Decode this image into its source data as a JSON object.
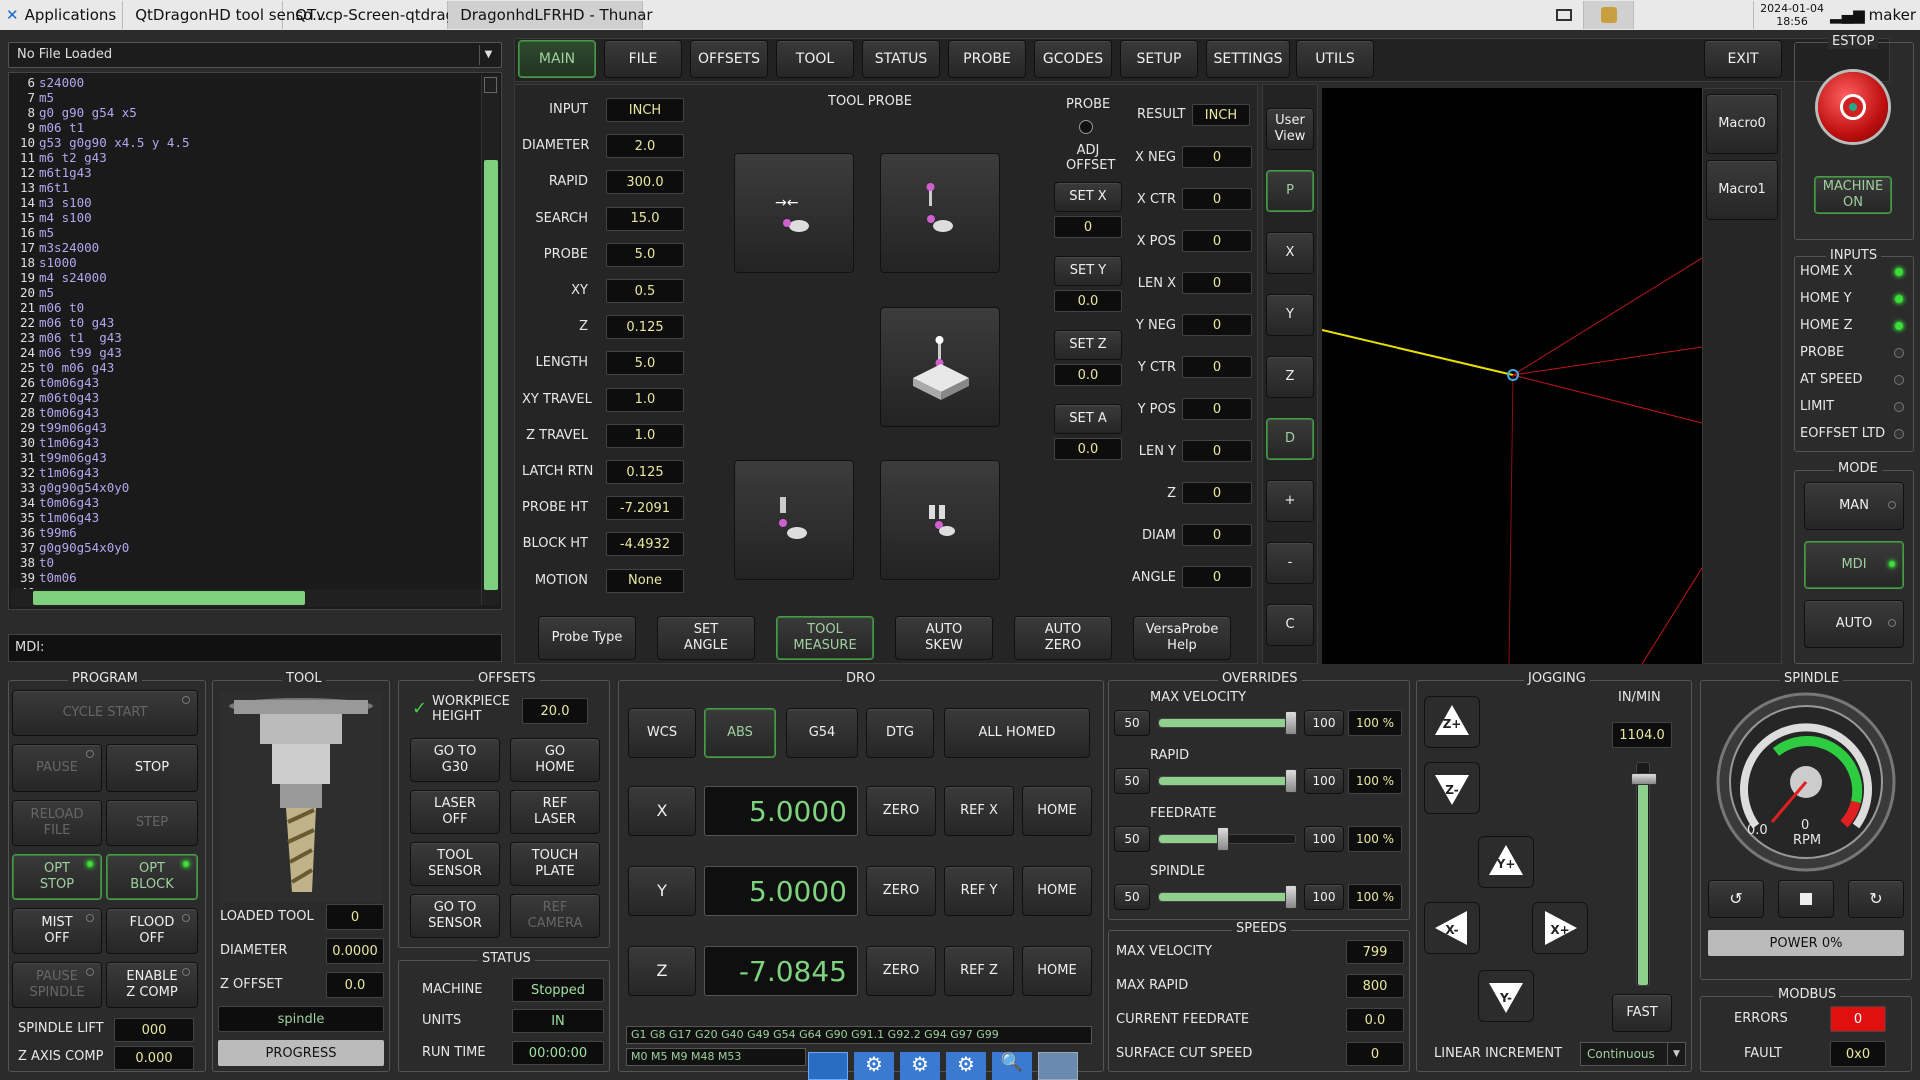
{
  "taskbar": {
    "items": [
      {
        "label": "Applications"
      },
      {
        "label": "QtDragonHD tool senso..."
      },
      {
        "label": "QTvcp-Screen-qtdragon..."
      },
      {
        "label": "DragonhdLFRHD - Thunar"
      }
    ],
    "date": "2024-01-04",
    "time": "18:56",
    "user": "maker"
  },
  "file_panel": {
    "file_label": "No File Loaded",
    "gcode_lines": [
      {
        "n": "6",
        "t": "s24000"
      },
      {
        "n": "7",
        "t": "m5"
      },
      {
        "n": "8",
        "t": "g0 g90 g54 x5"
      },
      {
        "n": "9",
        "t": "m06 t1"
      },
      {
        "n": "10",
        "t": "g53 g0g90 x4.5 y 4.5"
      },
      {
        "n": "11",
        "t": "m6 t2 g43"
      },
      {
        "n": "12",
        "t": "m6t1g43"
      },
      {
        "n": "13",
        "t": "m6t1"
      },
      {
        "n": "14",
        "t": "m3 s100"
      },
      {
        "n": "15",
        "t": "m4 s100"
      },
      {
        "n": "16",
        "t": "m5"
      },
      {
        "n": "17",
        "t": "m3s24000"
      },
      {
        "n": "18",
        "t": "s1000"
      },
      {
        "n": "19",
        "t": "m4 s24000"
      },
      {
        "n": "20",
        "t": "m5"
      },
      {
        "n": "21",
        "t": "m06 t0"
      },
      {
        "n": "22",
        "t": "m06 t0 g43"
      },
      {
        "n": "23",
        "t": "m06 t1  g43"
      },
      {
        "n": "24",
        "t": "m06 t99 g43"
      },
      {
        "n": "25",
        "t": "t0 m06 g43"
      },
      {
        "n": "26",
        "t": "t0m06g43"
      },
      {
        "n": "27",
        "t": "m06t0g43"
      },
      {
        "n": "28",
        "t": "t0m06g43"
      },
      {
        "n": "29",
        "t": "t99m06g43"
      },
      {
        "n": "30",
        "t": "t1m06g43"
      },
      {
        "n": "31",
        "t": "t99m06g43"
      },
      {
        "n": "32",
        "t": "t1m06g43"
      },
      {
        "n": "33",
        "t": "g0g90g54x0y0"
      },
      {
        "n": "34",
        "t": "t0m06g43"
      },
      {
        "n": "35",
        "t": "t1m06g43"
      },
      {
        "n": "36",
        "t": "t99m6"
      },
      {
        "n": "37",
        "t": "g0g90g54x0y0"
      },
      {
        "n": "38",
        "t": "t0"
      },
      {
        "n": "39",
        "t": "t0m06"
      },
      {
        "n": "40",
        "t": ""
      }
    ],
    "mdi_label": "MDI:"
  },
  "tabs": [
    "MAIN",
    "FILE",
    "OFFSETS",
    "TOOL",
    "STATUS",
    "PROBE",
    "GCODES",
    "SETUP",
    "SETTINGS",
    "UTILS"
  ],
  "exit_label": "EXIT",
  "probe": {
    "title": "TOOL PROBE",
    "params": [
      {
        "label": "INPUT",
        "value": "INCH"
      },
      {
        "label": "DIAMETER",
        "value": "2.0"
      },
      {
        "label": "RAPID",
        "value": "300.0"
      },
      {
        "label": "SEARCH",
        "value": "15.0"
      },
      {
        "label": "PROBE",
        "value": "5.0"
      },
      {
        "label": "XY",
        "value": "0.5"
      },
      {
        "label": "Z",
        "value": "0.125"
      },
      {
        "label": "LENGTH",
        "value": "5.0"
      },
      {
        "label": "XY TRAVEL",
        "value": "1.0"
      },
      {
        "label": "Z TRAVEL",
        "value": "1.0"
      },
      {
        "label": "LATCH RTN",
        "value": "0.125"
      },
      {
        "label": "PROBE HT",
        "value": "-7.2091"
      },
      {
        "label": "BLOCK HT",
        "value": "-4.4932"
      },
      {
        "label": "MOTION",
        "value": "None"
      }
    ],
    "probe_label": "PROBE",
    "adj_offset": "ADJ OFFSET",
    "sets": [
      {
        "label": "SET X",
        "value": "0"
      },
      {
        "label": "SET Y",
        "value": "0.0"
      },
      {
        "label": "SET Z",
        "value": "0.0"
      },
      {
        "label": "SET A",
        "value": "0.0"
      }
    ],
    "result_label": "RESULT",
    "result_value": "INCH",
    "results": [
      {
        "label": "X NEG",
        "value": "0"
      },
      {
        "label": "X CTR",
        "value": "0"
      },
      {
        "label": "X POS",
        "value": "0"
      },
      {
        "label": "LEN X",
        "value": "0"
      },
      {
        "label": "Y NEG",
        "value": "0"
      },
      {
        "label": "Y CTR",
        "value": "0"
      },
      {
        "label": "Y POS",
        "value": "0"
      },
      {
        "label": "LEN Y",
        "value": "0"
      },
      {
        "label": "Z",
        "value": "0"
      },
      {
        "label": "DIAM",
        "value": "0"
      },
      {
        "label": "ANGLE",
        "value": "0"
      }
    ],
    "bottom_buttons": [
      "Probe Type",
      "SET\nANGLE",
      "TOOL\nMEASURE",
      "AUTO\nSKEW",
      "AUTO\nZERO",
      "VersaProbe\nHelp"
    ]
  },
  "view_buttons": [
    "User\nView",
    "P",
    "X",
    "Y",
    "Z",
    "D",
    "+",
    "-",
    "C"
  ],
  "macros": [
    "Macro0",
    "Macro1"
  ],
  "estop": {
    "title": "ESTOP",
    "machine": "MACHINE\nON"
  },
  "inputs": {
    "title": "INPUTS",
    "items": [
      {
        "label": "HOME X",
        "on": true
      },
      {
        "label": "HOME Y",
        "on": true
      },
      {
        "label": "HOME Z",
        "on": true
      },
      {
        "label": "PROBE",
        "on": false
      },
      {
        "label": "AT SPEED",
        "on": false
      },
      {
        "label": "LIMIT",
        "on": false
      },
      {
        "label": "EOFFSET LTD",
        "on": false
      }
    ]
  },
  "mode": {
    "title": "MODE",
    "items": [
      "MAN",
      "MDI",
      "AUTO"
    ]
  },
  "program": {
    "title": "PROGRAM",
    "cycle_start": "CYCLE START",
    "pause": "PAUSE",
    "stop": "STOP",
    "reload": "RELOAD\nFILE",
    "step": "STEP",
    "opt_stop": "OPT\nSTOP",
    "opt_block": "OPT\nBLOCK",
    "mist": "MIST\nOFF",
    "flood": "FLOOD\nOFF",
    "pause_spindle": "PAUSE\nSPINDLE",
    "enable_zcomp": "ENABLE\nZ COMP",
    "spindle_lift_label": "SPINDLE LIFT",
    "spindle_lift": "000",
    "zaxis_comp_label": "Z AXIS COMP",
    "zaxis_comp": "0.000"
  },
  "tool": {
    "title": "TOOL",
    "loaded_label": "LOADED TOOL",
    "loaded": "0",
    "diameter_label": "DIAMETER",
    "diameter": "0.0000",
    "zoffset_label": "Z OFFSET",
    "zoffset": "0.0",
    "spindle": "spindle",
    "progress": "PROGRESS"
  },
  "offsets": {
    "title": "OFFSETS",
    "workpiece_label": "WORKPIECE\nHEIGHT",
    "workpiece_value": "20.0",
    "buttons": [
      "GO TO\nG30",
      "GO\nHOME",
      "LASER\nOFF",
      "REF\nLASER",
      "TOOL\nSENSOR",
      "TOUCH\nPLATE",
      "GO TO\nSENSOR",
      "REF\nCAMERA"
    ]
  },
  "status": {
    "title": "STATUS",
    "machine_label": "MACHINE",
    "machine": "Stopped",
    "units_label": "UNITS",
    "units": "IN",
    "runtime_label": "RUN TIME",
    "runtime": "00:00:00"
  },
  "dro": {
    "title": "DRO",
    "top": [
      "WCS",
      "ABS",
      "G54",
      "DTG",
      "ALL HOMED"
    ],
    "axes": [
      {
        "axis": "X",
        "value": "5.0000",
        "ref": "REF X"
      },
      {
        "axis": "Y",
        "value": "5.0000",
        "ref": "REF Y"
      },
      {
        "axis": "Z",
        "value": "-7.0845",
        "ref": "REF Z"
      }
    ],
    "zero": "ZERO",
    "home": "HOME",
    "gcodes": "G1 G8 G17 G20 G40 G49 G54 G64 G90 G91.1 G92.2 G94 G97 G99",
    "mcodes": "M0 M5 M9 M48 M53"
  },
  "overrides": {
    "title": "OVERRIDES",
    "items": [
      {
        "label": "MAX VELOCITY",
        "min": "50",
        "max": "100",
        "pct": "100 %",
        "frac": 1.0
      },
      {
        "label": "RAPID",
        "min": "50",
        "max": "100",
        "pct": "100 %",
        "frac": 1.0
      },
      {
        "label": "FEEDRATE",
        "min": "50",
        "max": "100",
        "pct": "100 %",
        "frac": 0.5
      },
      {
        "label": "SPINDLE",
        "min": "50",
        "max": "100",
        "pct": "100 %",
        "frac": 1.0
      }
    ]
  },
  "speeds": {
    "title": "SPEEDS",
    "items": [
      {
        "label": "MAX VELOCITY",
        "value": "799"
      },
      {
        "label": "MAX RAPID",
        "value": "800"
      },
      {
        "label": "CURRENT FEEDRATE",
        "value": "0.0"
      },
      {
        "label": "SURFACE CUT SPEED",
        "value": "0"
      }
    ]
  },
  "jogging": {
    "title": "JOGGING",
    "units": "IN/MIN",
    "rate": "1104.0",
    "fast": "FAST",
    "linear_label": "LINEAR INCREMENT",
    "linear_value": "Continuous",
    "buttons": [
      "Z+",
      "Z-",
      "Y+",
      "X-",
      "X+",
      "Y-"
    ]
  },
  "spindle": {
    "title": "SPINDLE",
    "gauge_low": "0.0",
    "rpm_value": "0",
    "rpm_label": "RPM",
    "power": "POWER 0%"
  },
  "modbus": {
    "title": "MODBUS",
    "errors_label": "ERRORS",
    "errors": "0",
    "fault_label": "FAULT",
    "fault": "0x0"
  }
}
